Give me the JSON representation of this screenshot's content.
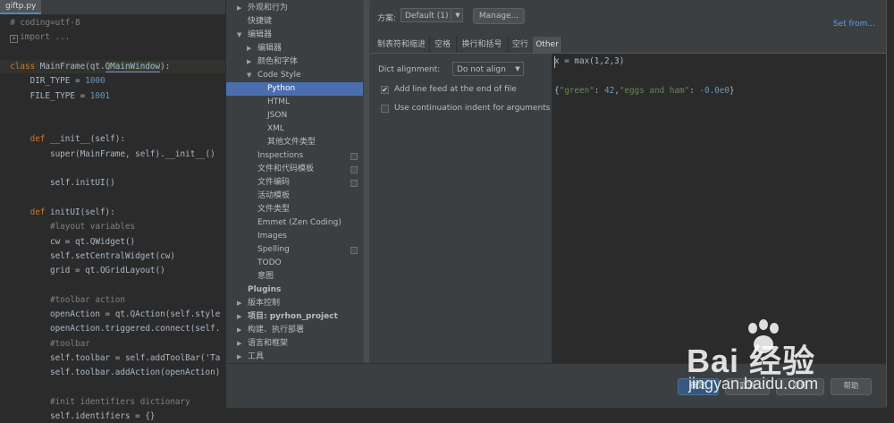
{
  "editor": {
    "file_tab": "giftp.py",
    "lines": [
      {
        "parts": [
          [
            "cm",
            "# coding=utf-8"
          ]
        ]
      },
      {
        "parts": [
          [
            "fold",
            "+"
          ],
          [
            "cm",
            "import ..."
          ]
        ]
      },
      {
        "parts": [
          [
            "txt",
            ""
          ]
        ]
      },
      {
        "hl": true,
        "parts": [
          [
            "kw",
            "class "
          ],
          [
            "txt",
            "MainFrame(qt."
          ],
          [
            "qm",
            "QMainWindow"
          ],
          [
            "txt",
            "):"
          ]
        ]
      },
      {
        "parts": [
          [
            "txt",
            "    DIR_TYPE = "
          ],
          [
            "num",
            "1000"
          ]
        ]
      },
      {
        "parts": [
          [
            "txt",
            "    FILE_TYPE = "
          ],
          [
            "num",
            "1001"
          ]
        ]
      },
      {
        "parts": [
          [
            "txt",
            ""
          ]
        ]
      },
      {
        "parts": [
          [
            "txt",
            ""
          ]
        ]
      },
      {
        "parts": [
          [
            "kw",
            "    def "
          ],
          [
            "txt",
            "__init__(self):"
          ]
        ]
      },
      {
        "parts": [
          [
            "txt",
            "        super(MainFrame, self).__init__()"
          ]
        ]
      },
      {
        "parts": [
          [
            "txt",
            ""
          ]
        ]
      },
      {
        "parts": [
          [
            "txt",
            "        self.initUI()"
          ]
        ]
      },
      {
        "parts": [
          [
            "txt",
            ""
          ]
        ]
      },
      {
        "parts": [
          [
            "kw",
            "    def "
          ],
          [
            "txt",
            "initUI(self):"
          ]
        ]
      },
      {
        "parts": [
          [
            "cm",
            "        #layout variables"
          ]
        ]
      },
      {
        "parts": [
          [
            "txt",
            "        cw = qt.QWidget()"
          ]
        ]
      },
      {
        "parts": [
          [
            "txt",
            "        self.setCentralWidget(cw)"
          ]
        ]
      },
      {
        "parts": [
          [
            "txt",
            "        grid = qt.QGridLayout()"
          ]
        ]
      },
      {
        "parts": [
          [
            "txt",
            ""
          ]
        ]
      },
      {
        "parts": [
          [
            "cm",
            "        #toolbar action"
          ]
        ]
      },
      {
        "parts": [
          [
            "txt",
            "        openAction = qt.QAction(self.style"
          ]
        ]
      },
      {
        "parts": [
          [
            "txt",
            "        openAction.triggered.connect(self."
          ]
        ]
      },
      {
        "parts": [
          [
            "cm",
            "        #toolbar"
          ]
        ]
      },
      {
        "parts": [
          [
            "txt",
            "        self.toolbar = self.addToolBar('Ta"
          ]
        ]
      },
      {
        "parts": [
          [
            "txt",
            "        self.toolbar.addAction(openAction)"
          ]
        ]
      },
      {
        "parts": [
          [
            "txt",
            ""
          ]
        ]
      },
      {
        "parts": [
          [
            "cm",
            "        #init identifiers dictionary"
          ]
        ]
      },
      {
        "parts": [
          [
            "txt",
            "        self.identifiers = {}"
          ]
        ]
      }
    ]
  },
  "tree": {
    "items": [
      {
        "label": "外观和行为",
        "indent": 0,
        "arrow": "▶",
        "bold": false
      },
      {
        "label": "快捷键",
        "indent": 0,
        "arrow": "",
        "bold": false
      },
      {
        "label": "编辑器",
        "indent": 0,
        "arrow": "▼",
        "bold": false
      },
      {
        "label": "编辑器",
        "indent": 1,
        "arrow": "▶",
        "bold": false
      },
      {
        "label": "颜色和字体",
        "indent": 1,
        "arrow": "▶",
        "bold": false
      },
      {
        "label": "Code Style",
        "indent": 1,
        "arrow": "▼",
        "bold": false
      },
      {
        "label": "Python",
        "indent": 2,
        "arrow": "",
        "bold": false,
        "selected": true
      },
      {
        "label": "HTML",
        "indent": 2,
        "arrow": "",
        "bold": false
      },
      {
        "label": "JSON",
        "indent": 2,
        "arrow": "",
        "bold": false
      },
      {
        "label": "XML",
        "indent": 2,
        "arrow": "",
        "bold": false
      },
      {
        "label": "其他文件类型",
        "indent": 2,
        "arrow": "",
        "bold": false
      },
      {
        "label": "Inspections",
        "indent": 1,
        "arrow": "",
        "bold": false,
        "copy": true
      },
      {
        "label": "文件和代码模板",
        "indent": 1,
        "arrow": "",
        "bold": false,
        "copy": true
      },
      {
        "label": "文件编码",
        "indent": 1,
        "arrow": "",
        "bold": false,
        "copy": true
      },
      {
        "label": "活动模板",
        "indent": 1,
        "arrow": "",
        "bold": false
      },
      {
        "label": "文件类型",
        "indent": 1,
        "arrow": "",
        "bold": false
      },
      {
        "label": "Emmet (Zen Coding)",
        "indent": 1,
        "arrow": "",
        "bold": false
      },
      {
        "label": "Images",
        "indent": 1,
        "arrow": "",
        "bold": false
      },
      {
        "label": "Spelling",
        "indent": 1,
        "arrow": "",
        "bold": false,
        "copy": true
      },
      {
        "label": "TODO",
        "indent": 1,
        "arrow": "",
        "bold": false
      },
      {
        "label": "意图",
        "indent": 1,
        "arrow": "",
        "bold": false
      },
      {
        "label": "Plugins",
        "indent": 0,
        "arrow": "",
        "bold": true
      },
      {
        "label": "版本控制",
        "indent": 0,
        "arrow": "▶",
        "bold": false
      },
      {
        "label": "项目: pyrhon_project",
        "indent": 0,
        "arrow": "▶",
        "bold": true
      },
      {
        "label": "构建、执行部署",
        "indent": 0,
        "arrow": "▶",
        "bold": false
      },
      {
        "label": "语言和框架",
        "indent": 0,
        "arrow": "▶",
        "bold": false
      },
      {
        "label": "工具",
        "indent": 0,
        "arrow": "▶",
        "bold": false
      }
    ]
  },
  "header": {
    "scheme_label": "方案:",
    "scheme_value": "Default (1)",
    "manage_label": "Manage...",
    "set_from": "Set from..."
  },
  "tabs": [
    {
      "label": "制表符和缩进",
      "active": false
    },
    {
      "label": "空格",
      "active": false
    },
    {
      "label": "换行和括号",
      "active": false
    },
    {
      "label": "空行",
      "active": false
    },
    {
      "label": "Other",
      "active": true
    }
  ],
  "options": {
    "dict_alignment_label": "Dict alignment:",
    "dict_alignment_value": "Do not align",
    "checkboxes": [
      {
        "label": "Add line feed at the end of file",
        "checked": true
      },
      {
        "label": "Use continuation indent for arguments",
        "checked": false
      }
    ]
  },
  "preview": {
    "line1": "x = max(1,2,3)",
    "line2_parts": [
      [
        "txt",
        "{"
      ],
      [
        "str",
        "\"green\""
      ],
      [
        "txt",
        ": "
      ],
      [
        "num",
        "42"
      ],
      [
        "txt",
        ","
      ],
      [
        "str",
        "\"eggs and ham\""
      ],
      [
        "txt",
        ": "
      ],
      [
        "num",
        "-0.0e0"
      ],
      [
        "txt",
        "}"
      ]
    ]
  },
  "footer": {
    "buttons": [
      "确定",
      "取消",
      "应用",
      "帮助"
    ]
  },
  "watermark": {
    "logo": "Bai  经验",
    "url": "jingyan.baidu.com"
  }
}
